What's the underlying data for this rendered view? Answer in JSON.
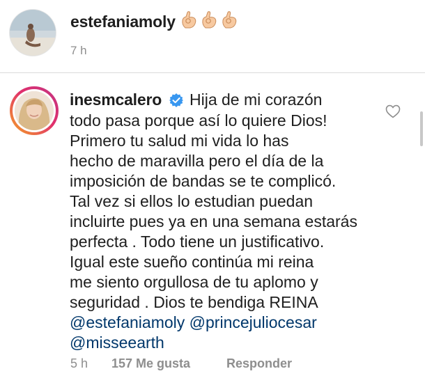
{
  "top_comment": {
    "username": "estefaniamoly",
    "time": "7 h",
    "emoji": "👌👌👌"
  },
  "main_comment": {
    "username": "inesmcalero",
    "lines": [
      "Hija de mi corazón",
      "todo pasa porque así lo quiere Dios!",
      "Primero tu salud mi vida lo has",
      "hecho de maravilla pero el día de la",
      "imposición de bandas se te complicó.",
      "Tal vez si ellos lo estudian puedan",
      "incluirte pues ya en una semana estarás",
      "perfecta . Todo tiene un justificativo.",
      "Igual este sueño continúa mi reina",
      "me siento orgullosa de tu aplomo y",
      "seguridad . Dios te bendiga REINA"
    ],
    "mention_1": "@estefaniamoly",
    "mention_2": "@princejuliocesar",
    "mention_3": "@misseearth",
    "time": "5 h",
    "likes": "157 Me gusta",
    "reply": "Responder"
  },
  "colors": {
    "text": "#1e1e1e",
    "secondary": "#8e8e8e",
    "mention": "#00376b",
    "verified": "#3897f0",
    "divider": "#dbdbdb"
  },
  "icons": {
    "verified": "verified-badge-icon",
    "heart": "heart-outline-icon",
    "hand": "ok-hand-icon"
  }
}
